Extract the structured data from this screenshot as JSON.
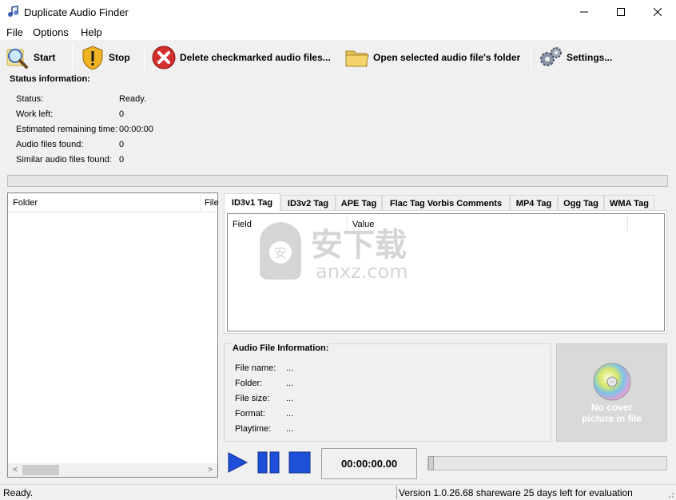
{
  "window": {
    "title": "Duplicate Audio Finder",
    "minimize_glyph": "—",
    "maximize_glyph": "☐",
    "close_glyph": "✕"
  },
  "menu": [
    "File",
    "Options",
    "Help"
  ],
  "toolbar": {
    "start": "Start",
    "stop": "Stop",
    "delete": "Delete checkmarked audio files...",
    "open_folder": "Open selected audio file's folder",
    "settings": "Settings..."
  },
  "status": {
    "group_title": "Status information:",
    "rows": [
      {
        "label": "Status:",
        "value": "Ready."
      },
      {
        "label": "Work left:",
        "value": "0"
      },
      {
        "label": "Estimated remaining time:",
        "value": "00:00:00"
      },
      {
        "label": "Audio files found:",
        "value": "0"
      },
      {
        "label": "Similar audio files found:",
        "value": "0"
      }
    ],
    "progress": 0
  },
  "folder_list": {
    "columns": [
      "Folder",
      "File"
    ]
  },
  "tabs": [
    "ID3v1 Tag",
    "ID3v2 Tag",
    "APE Tag",
    "Flac Tag Vorbis Comments",
    "MP4 Tag",
    "Ogg Tag",
    "WMA Tag"
  ],
  "active_tab": 0,
  "tag_list": {
    "columns": [
      "Field",
      "Value"
    ]
  },
  "watermark": {
    "cn": "安下载",
    "en": "anxz.com"
  },
  "audio_info": {
    "title": "Audio File Information:",
    "rows": [
      {
        "label": "File name:",
        "value": "..."
      },
      {
        "label": "Folder:",
        "value": "..."
      },
      {
        "label": "File size:",
        "value": "..."
      },
      {
        "label": "Format:",
        "value": "..."
      },
      {
        "label": "Playtime:",
        "value": "..."
      }
    ]
  },
  "cover": {
    "line1": "No cover",
    "line2": "picture in file"
  },
  "player": {
    "time": "00:00:00.00",
    "position": 0
  },
  "statusbar": {
    "left": "Ready.",
    "right": "Version 1.0.26.68 shareware 25 days left for evaluation"
  },
  "colors": {
    "accent_blue": "#1e4fd8",
    "delete_red": "#d32f2f",
    "folder_yellow": "#f5d36b"
  }
}
